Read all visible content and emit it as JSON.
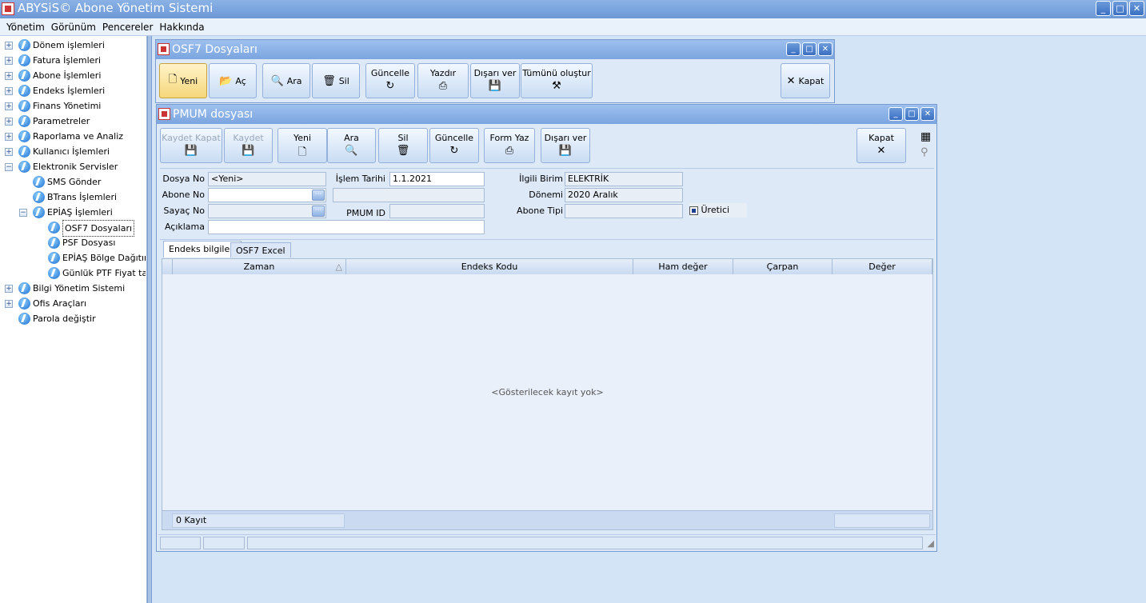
{
  "app": {
    "title": "ABYSiS© Abone Yönetim Sistemi",
    "win_buttons": [
      "_",
      "□",
      "✕"
    ]
  },
  "menu": [
    "Yönetim",
    "Görünüm",
    "Pencereler",
    "Hakkında"
  ],
  "tree": [
    {
      "label": "Dönem işlemleri",
      "exp": "+"
    },
    {
      "label": "Fatura İşlemleri",
      "exp": "+"
    },
    {
      "label": "Abone İşlemleri",
      "exp": "+"
    },
    {
      "label": "Endeks İşlemleri",
      "exp": "+"
    },
    {
      "label": "Finans Yönetimi",
      "exp": "+"
    },
    {
      "label": "Parametreler",
      "exp": "+"
    },
    {
      "label": "Raporlama ve Analiz",
      "exp": "+"
    },
    {
      "label": "Kullanıcı İşlemleri",
      "exp": "+"
    },
    {
      "label": "Elektronik Servisler",
      "exp": "−"
    },
    {
      "label": "SMS Gönder",
      "exp": ""
    },
    {
      "label": "BTrans İşlemleri",
      "exp": ""
    },
    {
      "label": "EPİAŞ İşlemleri",
      "exp": "−"
    },
    {
      "label": "OSF7 Dosyaları",
      "exp": ""
    },
    {
      "label": "PSF Dosyası",
      "exp": ""
    },
    {
      "label": "EPİAŞ Bölge Dağıtım Şi",
      "exp": ""
    },
    {
      "label": "Günlük PTF Fiyat tablo",
      "exp": ""
    },
    {
      "label": "Bilgi Yönetim Sistemi",
      "exp": "+"
    },
    {
      "label": "Ofis Araçları",
      "exp": "+"
    },
    {
      "label": "Parola değiştir",
      "exp": ""
    }
  ],
  "osf7": {
    "title": "OSF7 Dosyaları",
    "buttons": [
      {
        "label": "Yeni",
        "icon": "🗋"
      },
      {
        "label": "Aç",
        "icon": "📂"
      },
      {
        "label": "Ara",
        "icon": "🔍"
      },
      {
        "label": "Sil",
        "icon": "🗑"
      },
      {
        "label": "Güncelle",
        "icon": "↻"
      },
      {
        "label": "Yazdır",
        "icon": "⎙"
      },
      {
        "label": "Dışarı ver",
        "icon": "💾"
      },
      {
        "label": "Tümünü oluştur",
        "icon": "⚒"
      },
      {
        "label": "Kapat",
        "icon": "✕"
      }
    ]
  },
  "pmum": {
    "title": "PMUM dosyası",
    "buttons": [
      {
        "label": "Kaydet Kapat",
        "icon": "💾"
      },
      {
        "label": "Kaydet",
        "icon": "💾"
      },
      {
        "label": "Yeni",
        "icon": "🗋"
      },
      {
        "label": "Ara",
        "icon": "🔍"
      },
      {
        "label": "Sil",
        "icon": "🗑"
      },
      {
        "label": "Güncelle",
        "icon": "↻"
      },
      {
        "label": "Form Yaz",
        "icon": "⎙"
      },
      {
        "label": "Dışarı ver",
        "icon": "💾"
      },
      {
        "label": "Kapat",
        "icon": "✕"
      }
    ],
    "form": {
      "dosya_no_label": "Dosya No",
      "dosya_no": "<Yeni>",
      "islem_tarihi_label": "İşlem Tarihi",
      "islem_tarihi": "1.1.2021",
      "ilgili_birim_label": "İlgili Birim",
      "ilgili_birim": "ELEKTRİK",
      "abone_no_label": "Abone No",
      "abone_no": "",
      "donemi_label": "Dönemi",
      "donemi": "2020 Aralık",
      "sayac_no_label": "Sayaç No",
      "sayac_no": "",
      "pmum_id_label": "PMUM ID",
      "pmum_id": "",
      "abone_tipi_label": "Abone Tipi",
      "abone_tipi": "",
      "uretici_label": "Üretici",
      "aciklama_label": "Açıklama",
      "aciklama": ""
    },
    "tabs": [
      "Endeks bilgileri",
      "OSF7 Excel"
    ],
    "columns": [
      "Zaman",
      "Endeks Kodu",
      "Ham değer",
      "Çarpan",
      "Değer"
    ],
    "empty_text": "<Gösterilecek kayıt yok>",
    "record_count": "0 Kayıt"
  }
}
